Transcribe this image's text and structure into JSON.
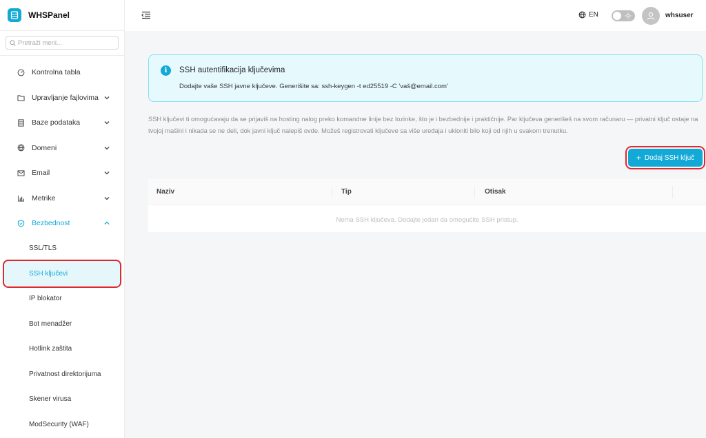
{
  "brand": {
    "name": "WHSPanel"
  },
  "search": {
    "placeholder": "Pretraži meni..."
  },
  "menu": [
    {
      "label": "Kontrolna tabla",
      "icon": "gauge-icon"
    },
    {
      "label": "Upravljanje fajlovima",
      "icon": "folder-icon"
    },
    {
      "label": "Baze podataka",
      "icon": "database-icon"
    },
    {
      "label": "Domeni",
      "icon": "globe-icon"
    },
    {
      "label": "Email",
      "icon": "mail-icon"
    },
    {
      "label": "Metrike",
      "icon": "bar-chart-icon"
    },
    {
      "label": "Bezbednost",
      "icon": "shield-icon"
    }
  ],
  "security_submenu": [
    {
      "label": "SSL/TLS"
    },
    {
      "label": "SSH ključevi"
    },
    {
      "label": "IP blokator"
    },
    {
      "label": "Bot menadžer"
    },
    {
      "label": "Hotlink zaštita"
    },
    {
      "label": "Privatnost direktorijuma"
    },
    {
      "label": "Skener virusa"
    },
    {
      "label": "ModSecurity (WAF)"
    }
  ],
  "topbar": {
    "language": "EN",
    "username": "whsuser"
  },
  "alert": {
    "title": "SSH autentifikacija ključevima",
    "text": "Dodajte vaše SSH javne ključeve. Generišite sa: ssh-keygen -t ed25519 -C 'vaš@email.com'"
  },
  "description": "SSH ključevi ti omogućavaju da se prijaviš na hosting nalog preko komandne linije bez lozinke, što je i bezbednije i praktičnije. Par ključeva generišeš na svom računaru — privatni ključ ostaje na tvojoj mašini i nikada se ne deli, dok javni ključ nalepiš ovde. Možeš registrovati ključeve sa više uređaja i ukloniti bilo koji od njih u svakom trenutku.",
  "add_button": {
    "label": "Dodaj SSH ključ"
  },
  "table": {
    "columns": [
      "Naziv",
      "Tip",
      "Otisak"
    ],
    "empty_text": "Nema SSH ključeva. Dodajte jedan da omogućite SSH pristup."
  },
  "colors": {
    "accent": "#13a9d6",
    "highlight": "#e0282d"
  }
}
